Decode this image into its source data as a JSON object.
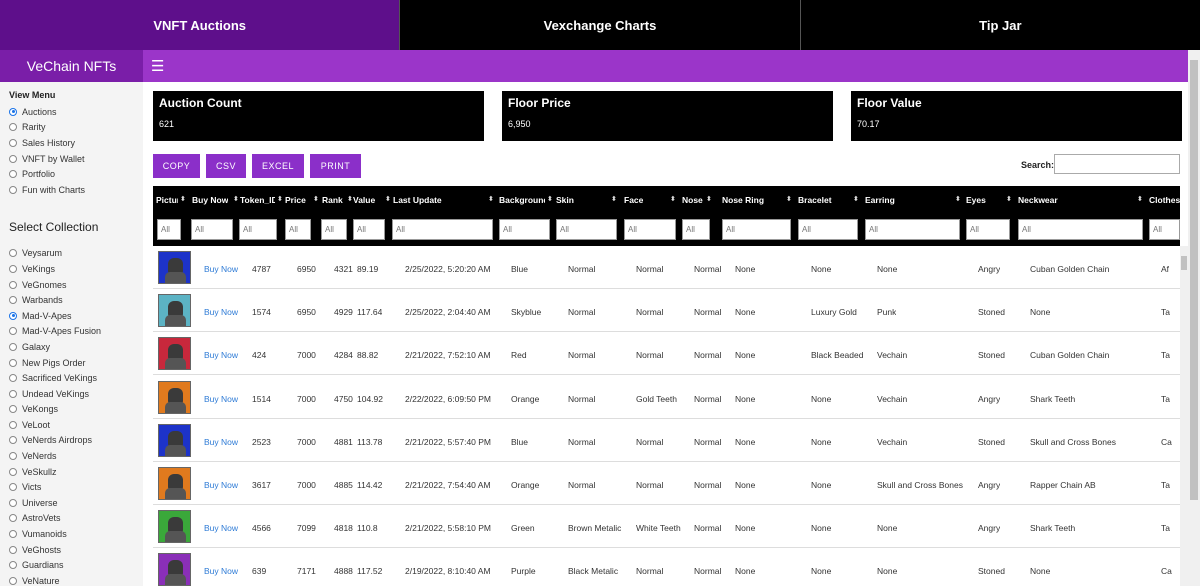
{
  "topnav": [
    {
      "label": "VNFT Auctions",
      "active": true
    },
    {
      "label": "Vexchange Charts",
      "active": false
    },
    {
      "label": "Tip Jar",
      "active": false
    }
  ],
  "brand": "VeChain NFTs",
  "menu_icon": "hamburger-icon",
  "sidebar": {
    "view_menu_title": "View Menu",
    "view_menu": [
      {
        "label": "Auctions",
        "selected": true
      },
      {
        "label": "Rarity",
        "selected": false
      },
      {
        "label": "Sales History",
        "selected": false
      },
      {
        "label": "VNFT by Wallet",
        "selected": false
      },
      {
        "label": "Portfolio",
        "selected": false
      },
      {
        "label": "Fun with Charts",
        "selected": false
      }
    ],
    "collection_title": "Select Collection",
    "collections": [
      {
        "label": "Veysarum",
        "selected": false
      },
      {
        "label": "VeKings",
        "selected": false
      },
      {
        "label": "VeGnomes",
        "selected": false
      },
      {
        "label": "Warbands",
        "selected": false
      },
      {
        "label": "Mad-V-Apes",
        "selected": true
      },
      {
        "label": "Mad-V-Apes Fusion",
        "selected": false
      },
      {
        "label": "Galaxy",
        "selected": false
      },
      {
        "label": "New Pigs Order",
        "selected": false
      },
      {
        "label": "Sacrificed VeKings",
        "selected": false
      },
      {
        "label": "Undead VeKings",
        "selected": false
      },
      {
        "label": "VeKongs",
        "selected": false
      },
      {
        "label": "VeLoot",
        "selected": false
      },
      {
        "label": "VeNerds Airdrops",
        "selected": false
      },
      {
        "label": "VeNerds",
        "selected": false
      },
      {
        "label": "VeSkullz",
        "selected": false
      },
      {
        "label": "Victs",
        "selected": false
      },
      {
        "label": "Universe",
        "selected": false
      },
      {
        "label": "AstroVets",
        "selected": false
      },
      {
        "label": "Vumanoids",
        "selected": false
      },
      {
        "label": "VeGhosts",
        "selected": false
      },
      {
        "label": "Guardians",
        "selected": false
      },
      {
        "label": "VeNature",
        "selected": false
      }
    ]
  },
  "stats": [
    {
      "title": "Auction Count",
      "value": "621"
    },
    {
      "title": "Floor Price",
      "value": "6,950"
    },
    {
      "title": "Floor Value",
      "value": "70.17"
    }
  ],
  "buttons": [
    "COPY",
    "CSV",
    "EXCEL",
    "PRINT"
  ],
  "search": {
    "label": "Search:",
    "value": ""
  },
  "table": {
    "columns": [
      "Picture",
      "Buy Now",
      "Token_ID",
      "Price",
      "Rank",
      "Value",
      "Last Update",
      "Background",
      "Skin",
      "Face",
      "Nose",
      "Nose Ring",
      "Bracelet",
      "Earring",
      "Eyes",
      "Neckwear",
      "Clothes"
    ],
    "filter_placeholder": "All",
    "rows": [
      {
        "picture_color": "#1d33c9",
        "buy": "Buy Now",
        "token": "4787",
        "price": "6950",
        "rank": "4321",
        "value": "89.19",
        "updated": "2/25/2022, 5:20:20 AM",
        "background": "Blue",
        "skin": "Normal",
        "face": "Normal",
        "nose": "Normal",
        "nose_ring": "None",
        "bracelet": "None",
        "earring": "None",
        "eyes": "Angry",
        "neckwear": "Cuban Golden Chain",
        "clothes": "Af"
      },
      {
        "picture_color": "#5cb3c4",
        "buy": "Buy Now",
        "token": "1574",
        "price": "6950",
        "rank": "4929",
        "value": "117.64",
        "updated": "2/25/2022, 2:04:40 AM",
        "background": "Skyblue",
        "skin": "Normal",
        "face": "Normal",
        "nose": "Normal",
        "nose_ring": "None",
        "bracelet": "Luxury Gold",
        "earring": "Punk",
        "eyes": "Stoned",
        "neckwear": "None",
        "clothes": "Ta"
      },
      {
        "picture_color": "#c8283c",
        "buy": "Buy Now",
        "token": "424",
        "price": "7000",
        "rank": "4284",
        "value": "88.82",
        "updated": "2/21/2022, 7:52:10 AM",
        "background": "Red",
        "skin": "Normal",
        "face": "Normal",
        "nose": "Normal",
        "nose_ring": "None",
        "bracelet": "Black Beaded",
        "earring": "Vechain",
        "eyes": "Stoned",
        "neckwear": "Cuban Golden Chain",
        "clothes": "Ta"
      },
      {
        "picture_color": "#e07a1e",
        "buy": "Buy Now",
        "token": "1514",
        "price": "7000",
        "rank": "4750",
        "value": "104.92",
        "updated": "2/22/2022, 6:09:50 PM",
        "background": "Orange",
        "skin": "Normal",
        "face": "Gold Teeth",
        "nose": "Normal",
        "nose_ring": "None",
        "bracelet": "None",
        "earring": "Vechain",
        "eyes": "Angry",
        "neckwear": "Shark Teeth",
        "clothes": "Ta"
      },
      {
        "picture_color": "#1d33c9",
        "buy": "Buy Now",
        "token": "2523",
        "price": "7000",
        "rank": "4881",
        "value": "113.78",
        "updated": "2/21/2022, 5:57:40 PM",
        "background": "Blue",
        "skin": "Normal",
        "face": "Normal",
        "nose": "Normal",
        "nose_ring": "None",
        "bracelet": "None",
        "earring": "Vechain",
        "eyes": "Stoned",
        "neckwear": "Skull and Cross Bones",
        "clothes": "Ca"
      },
      {
        "picture_color": "#e07a1e",
        "buy": "Buy Now",
        "token": "3617",
        "price": "7000",
        "rank": "4885",
        "value": "114.42",
        "updated": "2/21/2022, 7:54:40 AM",
        "background": "Orange",
        "skin": "Normal",
        "face": "Normal",
        "nose": "Normal",
        "nose_ring": "None",
        "bracelet": "None",
        "earring": "Skull and Cross Bones",
        "eyes": "Angry",
        "neckwear": "Rapper Chain AB",
        "clothes": "Ta"
      },
      {
        "picture_color": "#3aa83a",
        "buy": "Buy Now",
        "token": "4566",
        "price": "7099",
        "rank": "4818",
        "value": "110.8",
        "updated": "2/21/2022, 5:58:10 PM",
        "background": "Green",
        "skin": "Brown Metalic",
        "face": "White Teeth",
        "nose": "Normal",
        "nose_ring": "None",
        "bracelet": "None",
        "earring": "None",
        "eyes": "Angry",
        "neckwear": "Shark Teeth",
        "clothes": "Ta"
      },
      {
        "picture_color": "#8a2fb8",
        "buy": "Buy Now",
        "token": "639",
        "price": "7171",
        "rank": "4888",
        "value": "117.52",
        "updated": "2/19/2022, 8:10:40 AM",
        "background": "Purple",
        "skin": "Black Metalic",
        "face": "Normal",
        "nose": "Normal",
        "nose_ring": "None",
        "bracelet": "None",
        "earring": "None",
        "eyes": "Stoned",
        "neckwear": "None",
        "clothes": "Ca"
      }
    ]
  }
}
